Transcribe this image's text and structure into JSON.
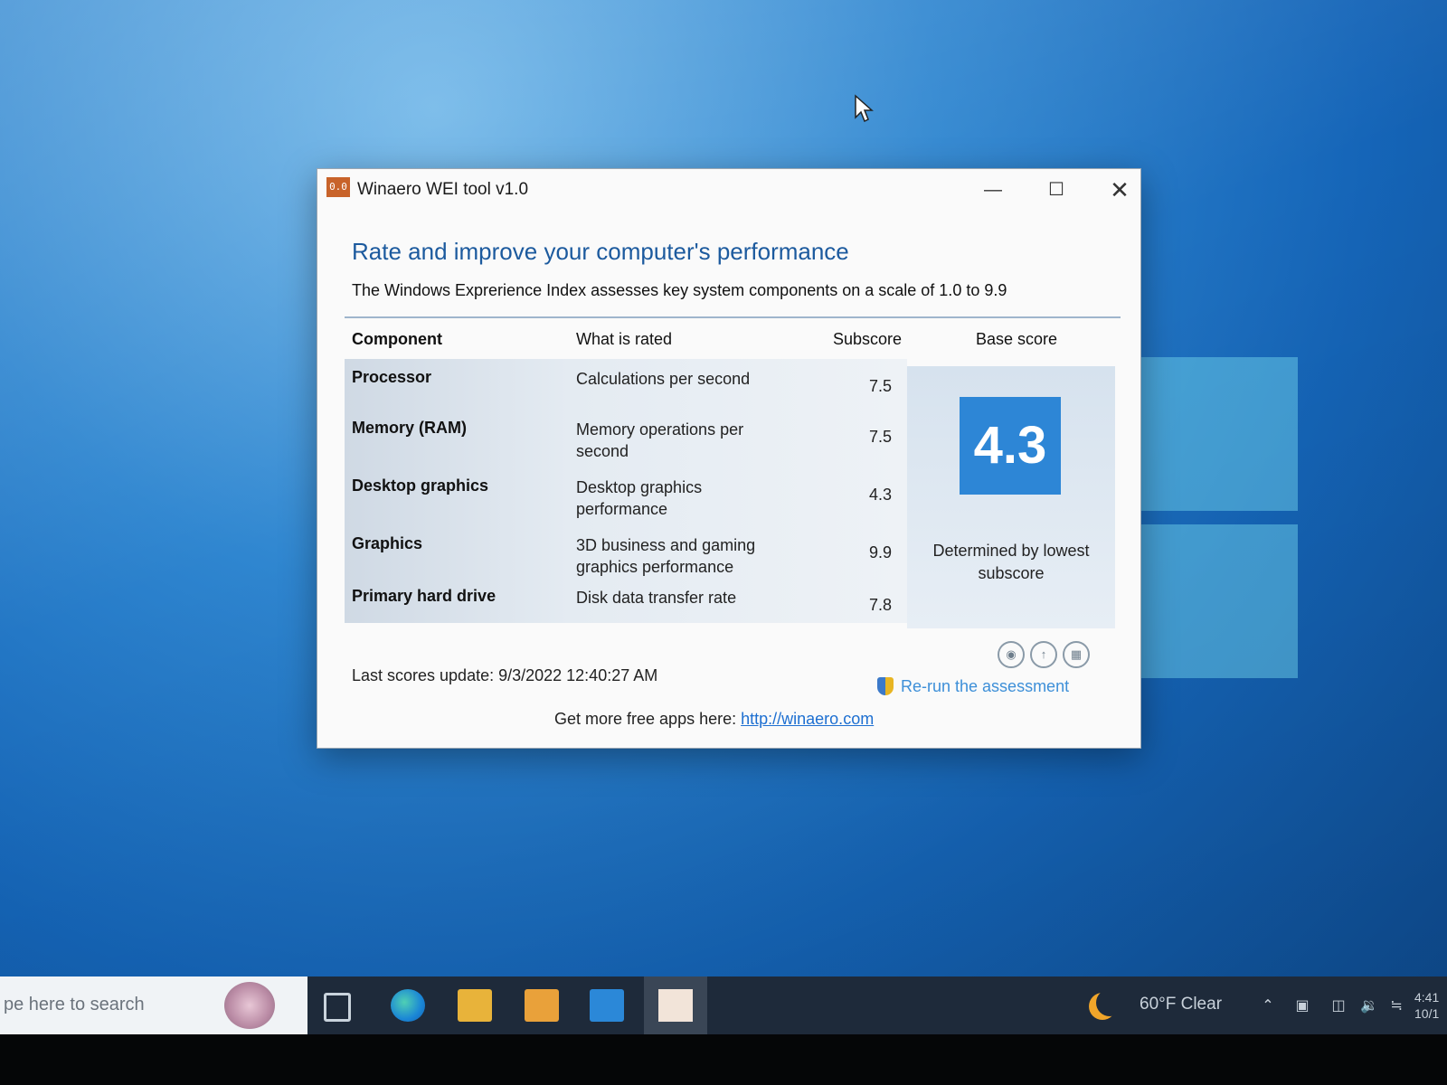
{
  "window": {
    "app_icon_text": "0.0",
    "title": "Winaero WEI tool v1.0",
    "minimize_glyph": "—",
    "maximize_glyph": "☐",
    "close_glyph": "✕"
  },
  "content": {
    "heading": "Rate and improve your computer's performance",
    "subtitle": "The Windows Exprerience Index assesses key system components on a scale of 1.0 to 9.9"
  },
  "table": {
    "headers": {
      "component": "Component",
      "what": "What is rated",
      "subscore": "Subscore",
      "base": "Base score"
    },
    "rows": [
      {
        "component": "Processor",
        "what": "Calculations per second",
        "subscore": "7.5"
      },
      {
        "component": "Memory (RAM)",
        "what": "Memory operations per second",
        "subscore": "7.5"
      },
      {
        "component": "Desktop graphics",
        "what": "Desktop graphics performance",
        "subscore": "4.3"
      },
      {
        "component": "Graphics",
        "what": "3D business and gaming graphics performance",
        "subscore": "9.9"
      },
      {
        "component": "Primary hard drive",
        "what": "Disk data transfer rate",
        "subscore": "7.8"
      }
    ]
  },
  "base_score": {
    "value": "4.3",
    "note": "Determined by lowest subscore"
  },
  "actions": {
    "icons": [
      "camera-icon",
      "upload-icon",
      "save-icon"
    ],
    "rerun_label": "Re-run the assessment"
  },
  "footer": {
    "last_update": "Last scores update: 9/3/2022 12:40:27 AM",
    "more_apps_text": "Get more free apps here:",
    "link_text": "http://winaero.com"
  },
  "taskbar": {
    "search_placeholder": "pe here to search",
    "weather": "60°F  Clear",
    "clock_time": "4:41",
    "clock_date": "10/1"
  },
  "colors": {
    "accent": "#2d86d6",
    "heading": "#1c5a9e",
    "link": "#1d6fd1"
  }
}
